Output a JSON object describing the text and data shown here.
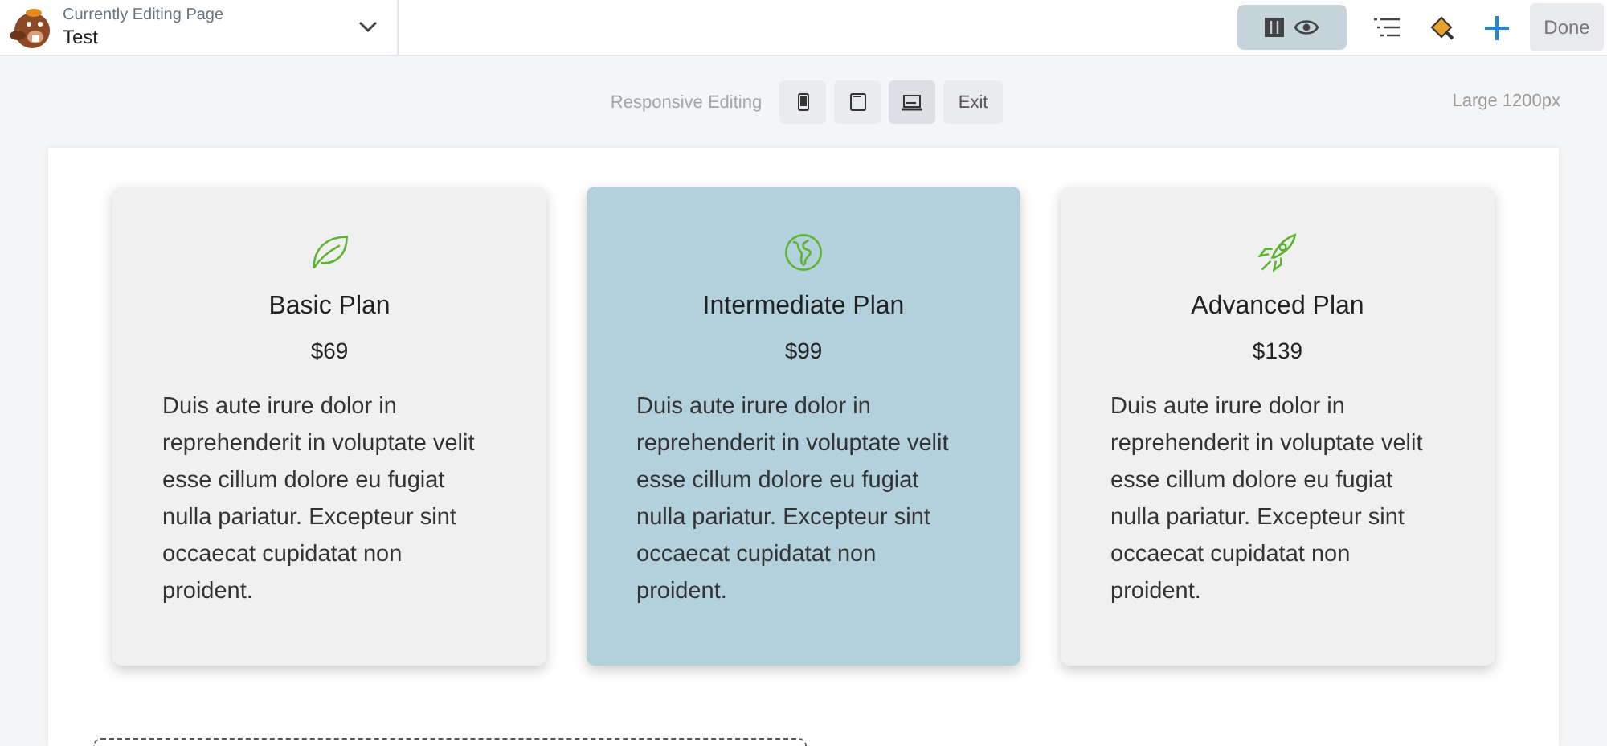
{
  "header": {
    "caption": "Currently Editing Page",
    "page_title": "Test",
    "done_label": "Done"
  },
  "responsive_bar": {
    "label": "Responsive Editing",
    "devices": [
      {
        "kind": "phone",
        "selected": false
      },
      {
        "kind": "tablet",
        "selected": false
      },
      {
        "kind": "laptop",
        "selected": true
      }
    ],
    "exit_label": "Exit",
    "size_label": "Large 1200px"
  },
  "plans": [
    {
      "title": "Basic Plan",
      "price": "$69",
      "description": "Duis aute irure dolor in reprehenderit in voluptate velit esse cillum dolore eu fugiat nulla pariatur. Excepteur sint occaecat cupidatat non proident.",
      "selected": false
    },
    {
      "title": "Intermediate Plan",
      "price": "$99",
      "description": "Duis aute irure dolor in reprehenderit in voluptate velit esse cillum dolore eu fugiat nulla pariatur. Excepteur sint occaecat cupidatat non proident.",
      "selected": true
    },
    {
      "title": "Advanced Plan",
      "price": "$139",
      "description": "Duis aute irure dolor in reprehenderit in voluptate velit esse cillum dolore eu fugiat nulla pariatur. Excepteur sint occaecat cupidatat non proident.",
      "selected": false
    }
  ]
}
